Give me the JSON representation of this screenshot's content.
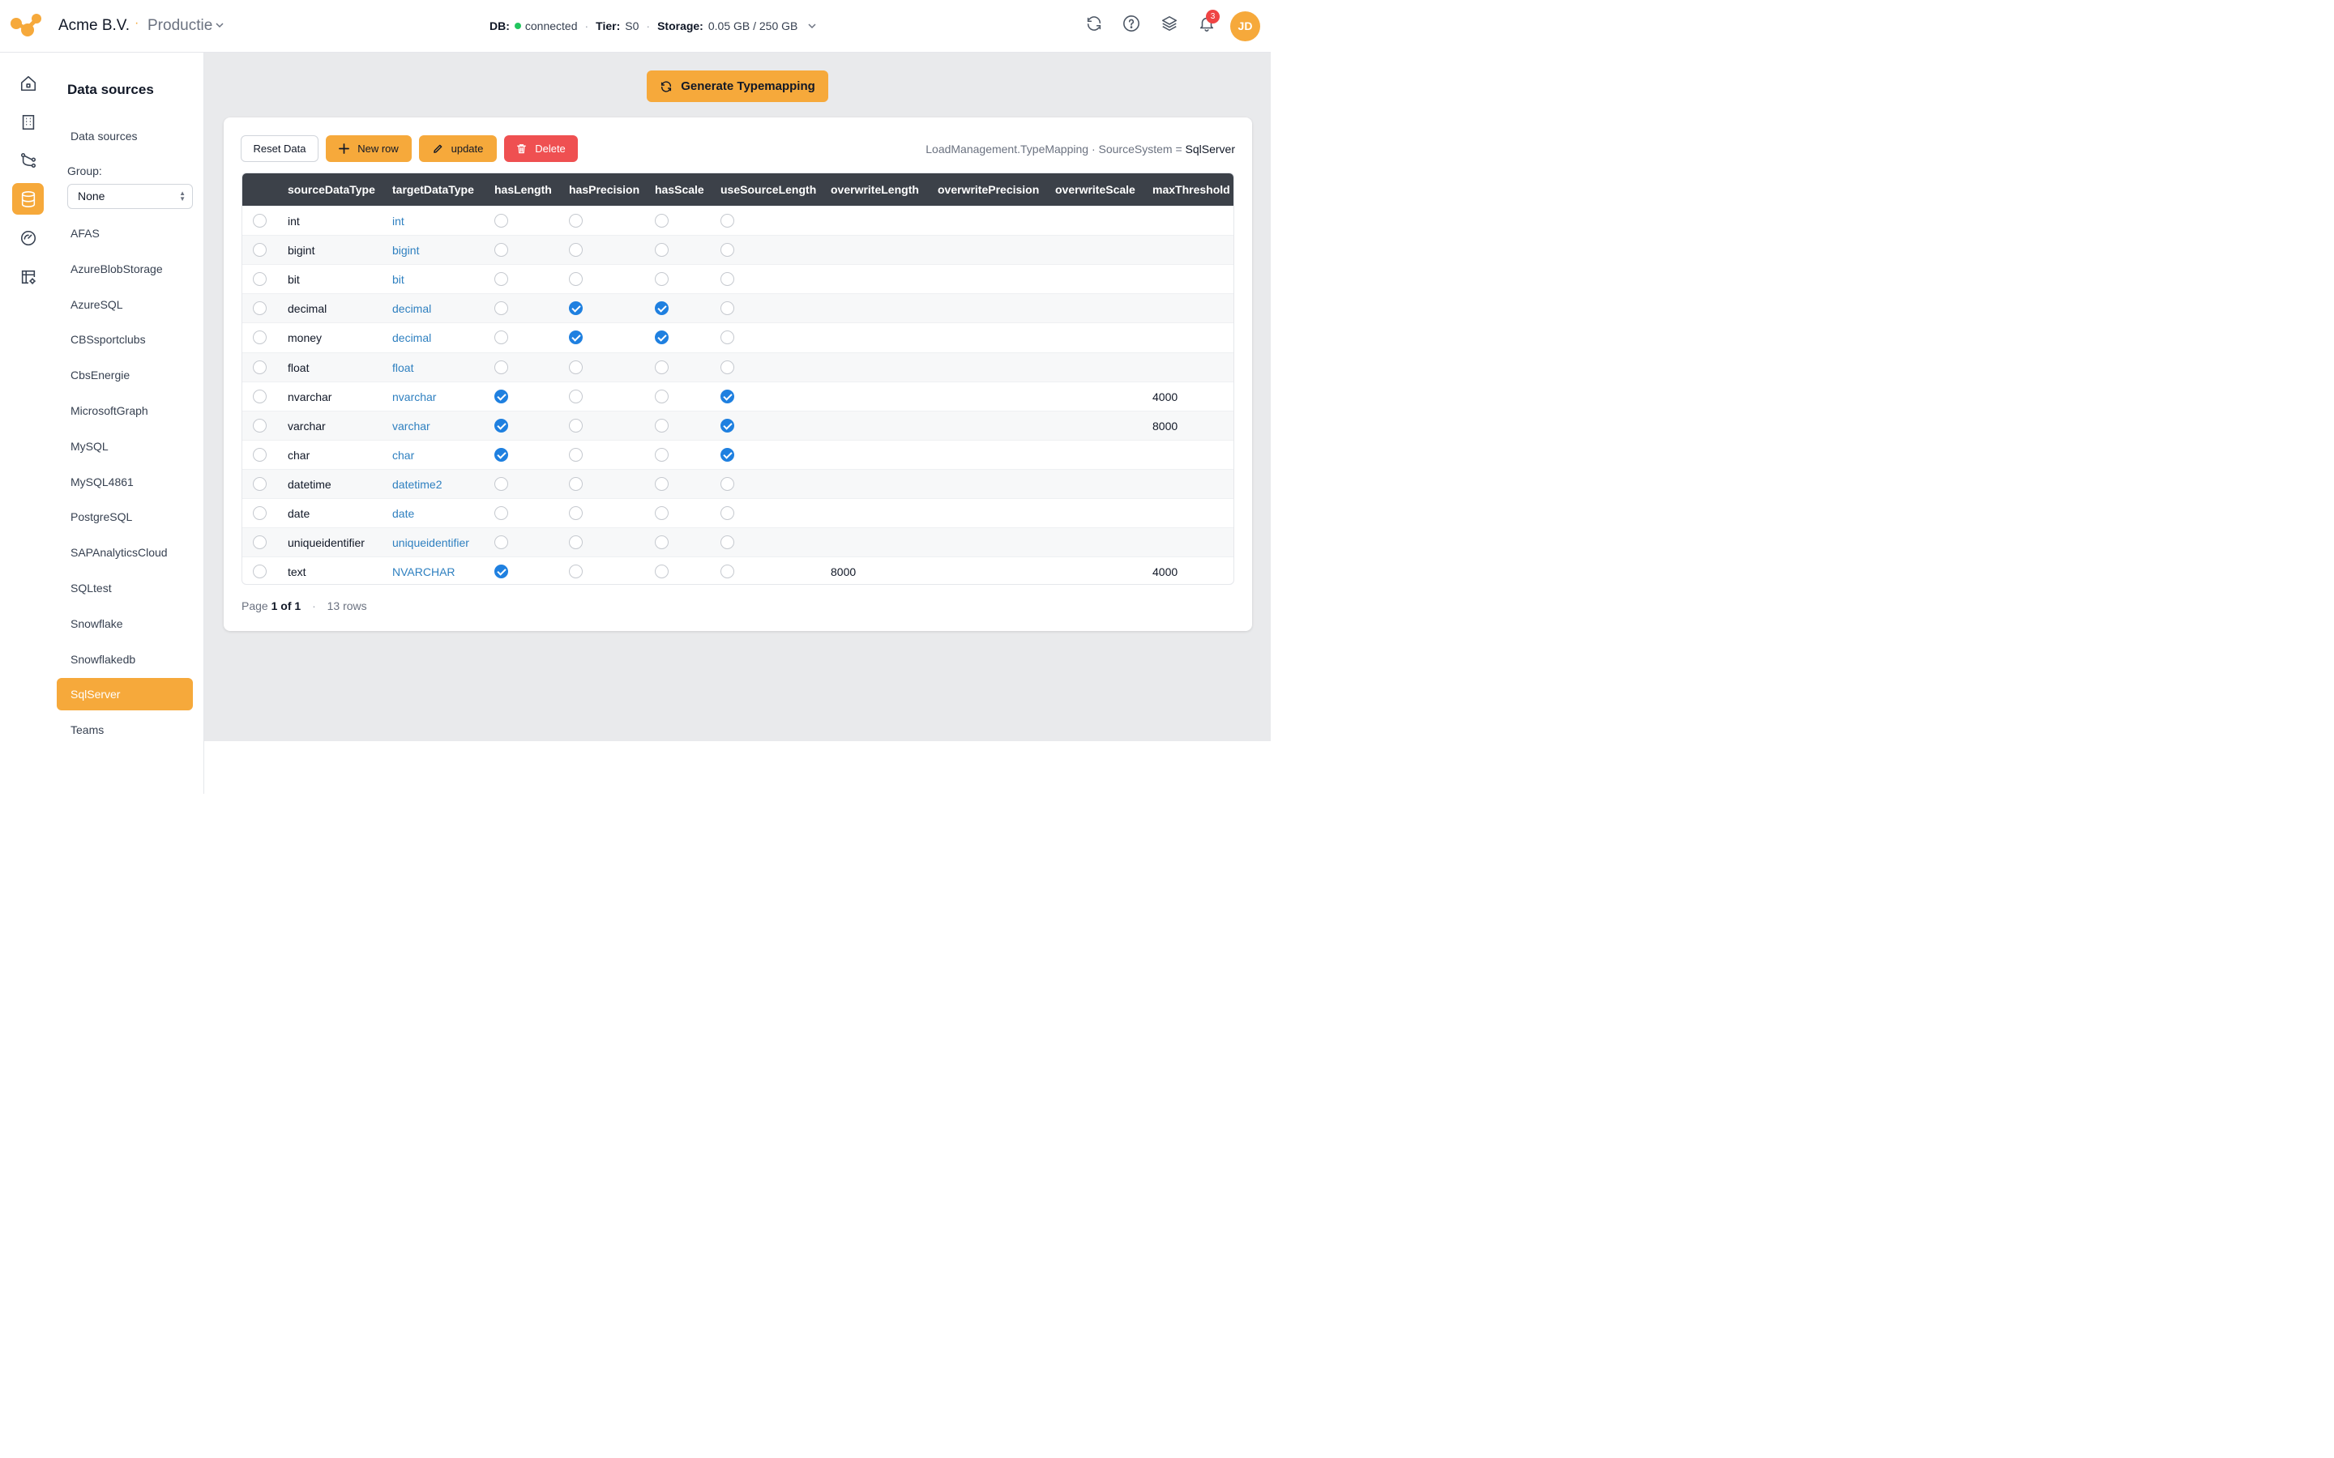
{
  "header": {
    "company": "Acme B.V.",
    "environment": "Productie",
    "status": {
      "db_label": "DB:",
      "db_value": "connected",
      "tier_label": "Tier:",
      "tier_value": "S0",
      "storage_label": "Storage:",
      "storage_value": "0.05 GB / 250 GB"
    },
    "notifications_count": "3",
    "user_initials": "JD",
    "colors": {
      "accent": "#f6a93b",
      "connected": "#22c55e",
      "badge": "#ef4444"
    }
  },
  "rail": {
    "items": [
      {
        "icon": "home-icon"
      },
      {
        "icon": "building-icon"
      },
      {
        "icon": "flow-icon"
      },
      {
        "icon": "database-icon",
        "active": true
      },
      {
        "icon": "gauge-icon"
      },
      {
        "icon": "table-settings-icon"
      }
    ]
  },
  "sidebar": {
    "title": "Data sources",
    "link": "Data sources",
    "group_label": "Group:",
    "group_value": "None",
    "items": [
      "AFAS",
      "AzureBlobStorage",
      "AzureSQL",
      "CBSsportclubs",
      "CbsEnergie",
      "MicrosoftGraph",
      "MySQL",
      "MySQL4861",
      "PostgreSQL",
      "SAPAnalyticsCloud",
      "SQLtest",
      "Snowflake",
      "Snowflakedb",
      "SqlServer",
      "Teams"
    ],
    "active_item": "SqlServer"
  },
  "main": {
    "generate_label": "Generate Typemapping",
    "toolbar": {
      "reset_label": "Reset Data",
      "new_row_label": "New row",
      "update_label": "update",
      "delete_label": "Delete"
    },
    "source_info": {
      "table": "LoadManagement.TypeMapping",
      "sep": "·",
      "field": "SourceSystem",
      "op": "=",
      "value": "SqlServer"
    },
    "table": {
      "columns": [
        "sourceDataType",
        "targetDataType",
        "hasLength",
        "hasPrecision",
        "hasScale",
        "useSourceLength",
        "overwriteLength",
        "overwritePrecision",
        "overwriteScale",
        "maxThreshold"
      ],
      "rows": [
        {
          "sourceDataType": "int",
          "targetDataType": "int",
          "hasLength": false,
          "hasPrecision": false,
          "hasScale": false,
          "useSourceLength": false,
          "overwriteLength": "",
          "overwritePrecision": "",
          "overwriteScale": "",
          "maxThreshold": ""
        },
        {
          "sourceDataType": "bigint",
          "targetDataType": "bigint",
          "hasLength": false,
          "hasPrecision": false,
          "hasScale": false,
          "useSourceLength": false,
          "overwriteLength": "",
          "overwritePrecision": "",
          "overwriteScale": "",
          "maxThreshold": ""
        },
        {
          "sourceDataType": "bit",
          "targetDataType": "bit",
          "hasLength": false,
          "hasPrecision": false,
          "hasScale": false,
          "useSourceLength": false,
          "overwriteLength": "",
          "overwritePrecision": "",
          "overwriteScale": "",
          "maxThreshold": ""
        },
        {
          "sourceDataType": "decimal",
          "targetDataType": "decimal",
          "hasLength": false,
          "hasPrecision": true,
          "hasScale": true,
          "useSourceLength": false,
          "overwriteLength": "",
          "overwritePrecision": "",
          "overwriteScale": "",
          "maxThreshold": ""
        },
        {
          "sourceDataType": "money",
          "targetDataType": "decimal",
          "hasLength": false,
          "hasPrecision": true,
          "hasScale": true,
          "useSourceLength": false,
          "overwriteLength": "",
          "overwritePrecision": "",
          "overwriteScale": "",
          "maxThreshold": ""
        },
        {
          "sourceDataType": "float",
          "targetDataType": "float",
          "hasLength": false,
          "hasPrecision": false,
          "hasScale": false,
          "useSourceLength": false,
          "overwriteLength": "",
          "overwritePrecision": "",
          "overwriteScale": "",
          "maxThreshold": ""
        },
        {
          "sourceDataType": "nvarchar",
          "targetDataType": "nvarchar",
          "hasLength": true,
          "hasPrecision": false,
          "hasScale": false,
          "useSourceLength": true,
          "overwriteLength": "",
          "overwritePrecision": "",
          "overwriteScale": "",
          "maxThreshold": "4000"
        },
        {
          "sourceDataType": "varchar",
          "targetDataType": "varchar",
          "hasLength": true,
          "hasPrecision": false,
          "hasScale": false,
          "useSourceLength": true,
          "overwriteLength": "",
          "overwritePrecision": "",
          "overwriteScale": "",
          "maxThreshold": "8000"
        },
        {
          "sourceDataType": "char",
          "targetDataType": "char",
          "hasLength": true,
          "hasPrecision": false,
          "hasScale": false,
          "useSourceLength": true,
          "overwriteLength": "",
          "overwritePrecision": "",
          "overwriteScale": "",
          "maxThreshold": ""
        },
        {
          "sourceDataType": "datetime",
          "targetDataType": "datetime2",
          "hasLength": false,
          "hasPrecision": false,
          "hasScale": false,
          "useSourceLength": false,
          "overwriteLength": "",
          "overwritePrecision": "",
          "overwriteScale": "",
          "maxThreshold": ""
        },
        {
          "sourceDataType": "date",
          "targetDataType": "date",
          "hasLength": false,
          "hasPrecision": false,
          "hasScale": false,
          "useSourceLength": false,
          "overwriteLength": "",
          "overwritePrecision": "",
          "overwriteScale": "",
          "maxThreshold": ""
        },
        {
          "sourceDataType": "uniqueidentifier",
          "targetDataType": "uniqueidentifier",
          "hasLength": false,
          "hasPrecision": false,
          "hasScale": false,
          "useSourceLength": false,
          "overwriteLength": "",
          "overwritePrecision": "",
          "overwriteScale": "",
          "maxThreshold": ""
        },
        {
          "sourceDataType": "text",
          "targetDataType": "NVARCHAR",
          "hasLength": true,
          "hasPrecision": false,
          "hasScale": false,
          "useSourceLength": false,
          "overwriteLength": "8000",
          "overwritePrecision": "",
          "overwriteScale": "",
          "maxThreshold": "4000"
        }
      ]
    },
    "pager": {
      "page_prefix": "Page",
      "page_value": "1 of 1",
      "sep": "·",
      "rows_text": "13 rows"
    }
  }
}
